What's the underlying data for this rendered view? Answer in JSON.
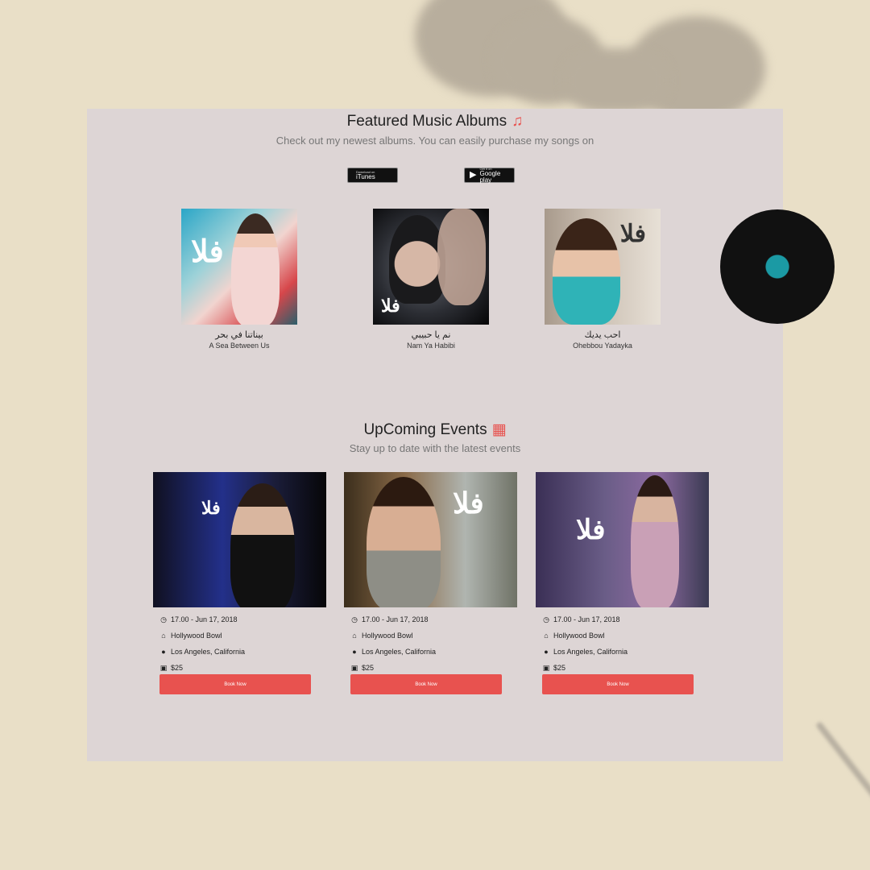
{
  "albums_section": {
    "title": "Featured Music Albums",
    "title_icon": "music-note-icon",
    "subtitle": "Check out my newest albums. You can easily purchase my songs on",
    "stores": [
      {
        "small": "Download on",
        "big": "iTunes",
        "icon": "apple-icon"
      },
      {
        "small": "Get it on",
        "big": "Google play",
        "icon": "play-icon"
      }
    ],
    "albums": [
      {
        "title_ar": "بيناتنا في بحر",
        "title_en": "A Sea Between Us"
      },
      {
        "title_ar": "نم يا حبيبي",
        "title_en": "Nam Ya Habibi"
      },
      {
        "title_ar": "احب يديك",
        "title_en": "Ohebbou Yadayka"
      }
    ]
  },
  "events_section": {
    "title": "UpComing Events",
    "title_icon": "calendar-icon",
    "subtitle": "Stay up to date with the latest events",
    "events": [
      {
        "time": "17.00 - Jun 17, 2018",
        "venue": "Hollywood Bowl",
        "location": "Los Angeles, California",
        "price": "$25",
        "button": "Book Now"
      },
      {
        "time": "17.00 - Jun 17, 2018",
        "venue": "Hollywood Bowl",
        "location": "Los Angeles, California",
        "price": "$25",
        "button": "Book Now"
      },
      {
        "time": "17.00 - Jun 17, 2018",
        "venue": "Hollywood Bowl",
        "location": "Los Angeles, California",
        "price": "$25",
        "button": "Book Now"
      }
    ]
  },
  "colors": {
    "accent": "#e8524f",
    "panel": "#ddd5d5",
    "background": "#e9dfc7"
  }
}
